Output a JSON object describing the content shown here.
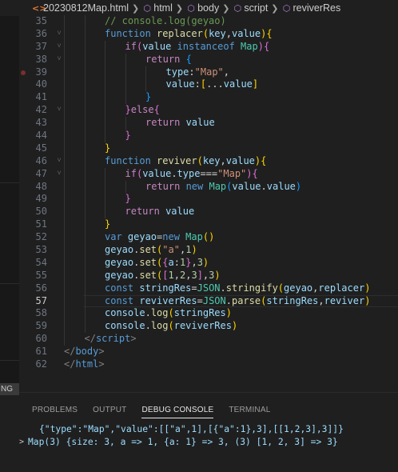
{
  "breadcrumb": {
    "file_icon": "<>",
    "file": "20230812Map.html",
    "items": [
      "html",
      "body",
      "script",
      "reviverRes"
    ]
  },
  "sidebar_tab": "NG",
  "editor": {
    "lines": [
      {
        "n": "35",
        "fold": "",
        "bp": false,
        "active": false,
        "indent": 2,
        "tokens": [
          [
            "t-com",
            "// console.log(geyao)"
          ]
        ]
      },
      {
        "n": "36",
        "fold": "v",
        "bp": false,
        "active": false,
        "indent": 2,
        "tokens": [
          [
            "t-kw",
            "function "
          ],
          [
            "t-fn",
            "replacer"
          ],
          [
            "t-b1",
            "("
          ],
          [
            "t-var",
            "key"
          ],
          [
            "t-pun",
            ","
          ],
          [
            "t-var",
            "value"
          ],
          [
            "t-b1",
            ")"
          ],
          [
            "t-b1",
            "{"
          ]
        ]
      },
      {
        "n": "37",
        "fold": "v",
        "bp": false,
        "active": false,
        "indent": 3,
        "tokens": [
          [
            "t-ctl",
            "if"
          ],
          [
            "t-b2",
            "("
          ],
          [
            "t-var",
            "value "
          ],
          [
            "t-kw",
            "instanceof "
          ],
          [
            "t-cls",
            "Map"
          ],
          [
            "t-b2",
            ")"
          ],
          [
            "t-b2",
            "{"
          ]
        ]
      },
      {
        "n": "38",
        "fold": "v",
        "bp": false,
        "active": false,
        "indent": 4,
        "tokens": [
          [
            "t-ctl",
            "return "
          ],
          [
            "t-b3",
            "{"
          ]
        ]
      },
      {
        "n": "39",
        "fold": "",
        "bp": true,
        "active": false,
        "indent": 5,
        "tokens": [
          [
            "t-var",
            "type"
          ],
          [
            "t-pun",
            ":"
          ],
          [
            "t-str",
            "\"Map\""
          ],
          [
            "t-pun",
            ","
          ]
        ]
      },
      {
        "n": "40",
        "fold": "",
        "bp": false,
        "active": false,
        "indent": 5,
        "tokens": [
          [
            "t-var",
            "value"
          ],
          [
            "t-pun",
            ":"
          ],
          [
            "t-b1",
            "["
          ],
          [
            "t-pun",
            "..."
          ],
          [
            "t-var",
            "value"
          ],
          [
            "t-b1",
            "]"
          ]
        ]
      },
      {
        "n": "41",
        "fold": "",
        "bp": false,
        "active": false,
        "indent": 4,
        "tokens": [
          [
            "t-b3",
            "}"
          ]
        ]
      },
      {
        "n": "42",
        "fold": "v",
        "bp": false,
        "active": false,
        "indent": 3,
        "tokens": [
          [
            "t-b2",
            "}"
          ],
          [
            "t-ctl",
            "else"
          ],
          [
            "t-b2",
            "{"
          ]
        ]
      },
      {
        "n": "43",
        "fold": "",
        "bp": false,
        "active": false,
        "indent": 4,
        "tokens": [
          [
            "t-ctl",
            "return "
          ],
          [
            "t-var",
            "value"
          ]
        ]
      },
      {
        "n": "44",
        "fold": "",
        "bp": false,
        "active": false,
        "indent": 3,
        "tokens": [
          [
            "t-b2",
            "}"
          ]
        ]
      },
      {
        "n": "45",
        "fold": "",
        "bp": false,
        "active": false,
        "indent": 2,
        "tokens": [
          [
            "t-b1",
            "}"
          ]
        ]
      },
      {
        "n": "46",
        "fold": "v",
        "bp": false,
        "active": false,
        "indent": 2,
        "tokens": [
          [
            "t-kw",
            "function "
          ],
          [
            "t-fn",
            "reviver"
          ],
          [
            "t-b1",
            "("
          ],
          [
            "t-var",
            "key"
          ],
          [
            "t-pun",
            ","
          ],
          [
            "t-var",
            "value"
          ],
          [
            "t-b1",
            ")"
          ],
          [
            "t-b1",
            "{"
          ]
        ]
      },
      {
        "n": "47",
        "fold": "v",
        "bp": false,
        "active": false,
        "indent": 3,
        "tokens": [
          [
            "t-ctl",
            "if"
          ],
          [
            "t-b2",
            "("
          ],
          [
            "t-var",
            "value"
          ],
          [
            "t-pun",
            "."
          ],
          [
            "t-var",
            "type"
          ],
          [
            "t-pun",
            "==="
          ],
          [
            "t-str",
            "\"Map\""
          ],
          [
            "t-b2",
            ")"
          ],
          [
            "t-b2",
            "{"
          ]
        ]
      },
      {
        "n": "48",
        "fold": "",
        "bp": false,
        "active": false,
        "indent": 4,
        "tokens": [
          [
            "t-ctl",
            "return "
          ],
          [
            "t-kw",
            "new "
          ],
          [
            "t-cls",
            "Map"
          ],
          [
            "t-b3",
            "("
          ],
          [
            "t-var",
            "value"
          ],
          [
            "t-pun",
            "."
          ],
          [
            "t-var",
            "value"
          ],
          [
            "t-b3",
            ")"
          ]
        ]
      },
      {
        "n": "49",
        "fold": "",
        "bp": false,
        "active": false,
        "indent": 3,
        "tokens": [
          [
            "t-b2",
            "}"
          ]
        ]
      },
      {
        "n": "50",
        "fold": "",
        "bp": false,
        "active": false,
        "indent": 3,
        "tokens": [
          [
            "t-ctl",
            "return "
          ],
          [
            "t-var",
            "value"
          ]
        ]
      },
      {
        "n": "51",
        "fold": "",
        "bp": false,
        "active": false,
        "indent": 2,
        "tokens": [
          [
            "t-b1",
            "}"
          ]
        ]
      },
      {
        "n": "52",
        "fold": "",
        "bp": false,
        "active": false,
        "indent": 2,
        "tokens": [
          [
            "t-kw",
            "var "
          ],
          [
            "t-var",
            "geyao"
          ],
          [
            "t-pun",
            "="
          ],
          [
            "t-kw",
            "new "
          ],
          [
            "t-cls",
            "Map"
          ],
          [
            "t-b1",
            "()"
          ]
        ]
      },
      {
        "n": "53",
        "fold": "",
        "bp": false,
        "active": false,
        "indent": 2,
        "tokens": [
          [
            "t-var",
            "geyao"
          ],
          [
            "t-pun",
            "."
          ],
          [
            "t-fn",
            "set"
          ],
          [
            "t-b1",
            "("
          ],
          [
            "t-str",
            "\"a\""
          ],
          [
            "t-pun",
            ","
          ],
          [
            "t-num",
            "1"
          ],
          [
            "t-b1",
            ")"
          ]
        ]
      },
      {
        "n": "54",
        "fold": "",
        "bp": false,
        "active": false,
        "indent": 2,
        "tokens": [
          [
            "t-var",
            "geyao"
          ],
          [
            "t-pun",
            "."
          ],
          [
            "t-fn",
            "set"
          ],
          [
            "t-b1",
            "("
          ],
          [
            "t-b2",
            "{"
          ],
          [
            "t-var",
            "a"
          ],
          [
            "t-pun",
            ":"
          ],
          [
            "t-num",
            "1"
          ],
          [
            "t-b2",
            "}"
          ],
          [
            "t-pun",
            ","
          ],
          [
            "t-num",
            "3"
          ],
          [
            "t-b1",
            ")"
          ]
        ]
      },
      {
        "n": "55",
        "fold": "",
        "bp": false,
        "active": false,
        "indent": 2,
        "tokens": [
          [
            "t-var",
            "geyao"
          ],
          [
            "t-pun",
            "."
          ],
          [
            "t-fn",
            "set"
          ],
          [
            "t-b1",
            "("
          ],
          [
            "t-b2",
            "["
          ],
          [
            "t-num",
            "1"
          ],
          [
            "t-pun",
            ","
          ],
          [
            "t-num",
            "2"
          ],
          [
            "t-pun",
            ","
          ],
          [
            "t-num",
            "3"
          ],
          [
            "t-b2",
            "]"
          ],
          [
            "t-pun",
            ","
          ],
          [
            "t-num",
            "3"
          ],
          [
            "t-b1",
            ")"
          ]
        ]
      },
      {
        "n": "56",
        "fold": "",
        "bp": false,
        "active": false,
        "indent": 2,
        "tokens": [
          [
            "t-kw",
            "const "
          ],
          [
            "t-var",
            "stringRes"
          ],
          [
            "t-pun",
            "="
          ],
          [
            "t-cls",
            "JSON"
          ],
          [
            "t-pun",
            "."
          ],
          [
            "t-fn",
            "stringify"
          ],
          [
            "t-b1",
            "("
          ],
          [
            "t-var",
            "geyao"
          ],
          [
            "t-pun",
            ","
          ],
          [
            "t-var",
            "replacer"
          ],
          [
            "t-b1",
            ")"
          ]
        ]
      },
      {
        "n": "57",
        "fold": "",
        "bp": false,
        "active": true,
        "indent": 2,
        "tokens": [
          [
            "t-kw",
            "const "
          ],
          [
            "t-var",
            "reviverRes"
          ],
          [
            "t-pun",
            "="
          ],
          [
            "t-cls",
            "JSON"
          ],
          [
            "t-pun",
            "."
          ],
          [
            "t-fn",
            "parse"
          ],
          [
            "t-b1",
            "("
          ],
          [
            "t-var",
            "stringRes"
          ],
          [
            "t-pun",
            ","
          ],
          [
            "t-var",
            "reviver"
          ],
          [
            "t-b1",
            ")"
          ]
        ]
      },
      {
        "n": "58",
        "fold": "",
        "bp": false,
        "active": false,
        "indent": 2,
        "tokens": [
          [
            "t-var",
            "console"
          ],
          [
            "t-pun",
            "."
          ],
          [
            "t-fn",
            "log"
          ],
          [
            "t-b1",
            "("
          ],
          [
            "t-var",
            "stringRes"
          ],
          [
            "t-b1",
            ")"
          ]
        ]
      },
      {
        "n": "59",
        "fold": "",
        "bp": false,
        "active": false,
        "indent": 2,
        "tokens": [
          [
            "t-var",
            "console"
          ],
          [
            "t-pun",
            "."
          ],
          [
            "t-fn",
            "log"
          ],
          [
            "t-b1",
            "("
          ],
          [
            "t-var",
            "reviverRes"
          ],
          [
            "t-b1",
            ")"
          ]
        ]
      },
      {
        "n": "60",
        "fold": "",
        "bp": false,
        "active": false,
        "indent": 1,
        "tokens": [
          [
            "t-tag",
            "</"
          ],
          [
            "t-tagn",
            "script"
          ],
          [
            "t-tag",
            ">"
          ]
        ]
      },
      {
        "n": "61",
        "fold": "",
        "bp": false,
        "active": false,
        "indent": 0,
        "tokens": [
          [
            "t-tag",
            "</"
          ],
          [
            "t-tagn",
            "body"
          ],
          [
            "t-tag",
            ">"
          ]
        ]
      },
      {
        "n": "62",
        "fold": "",
        "bp": false,
        "active": false,
        "indent": 0,
        "tokens": [
          [
            "t-tag",
            "</"
          ],
          [
            "t-tagn",
            "html"
          ],
          [
            "t-tag",
            ">"
          ]
        ]
      }
    ]
  },
  "panel": {
    "tabs": [
      {
        "label": "PROBLEMS",
        "active": false
      },
      {
        "label": "OUTPUT",
        "active": false
      },
      {
        "label": "DEBUG CONSOLE",
        "active": true
      },
      {
        "label": "TERMINAL",
        "active": false
      }
    ],
    "console": [
      {
        "chevron": "",
        "text": "{\"type\":\"Map\",\"value\":[[\"a\",1],[{\"a\":1},3],[[1,2,3],3]]}"
      },
      {
        "chevron": ">",
        "text": "Map(3) {size: 3, a => 1, {a: 1} => 3, (3) [1, 2, 3] => 3}"
      }
    ]
  }
}
